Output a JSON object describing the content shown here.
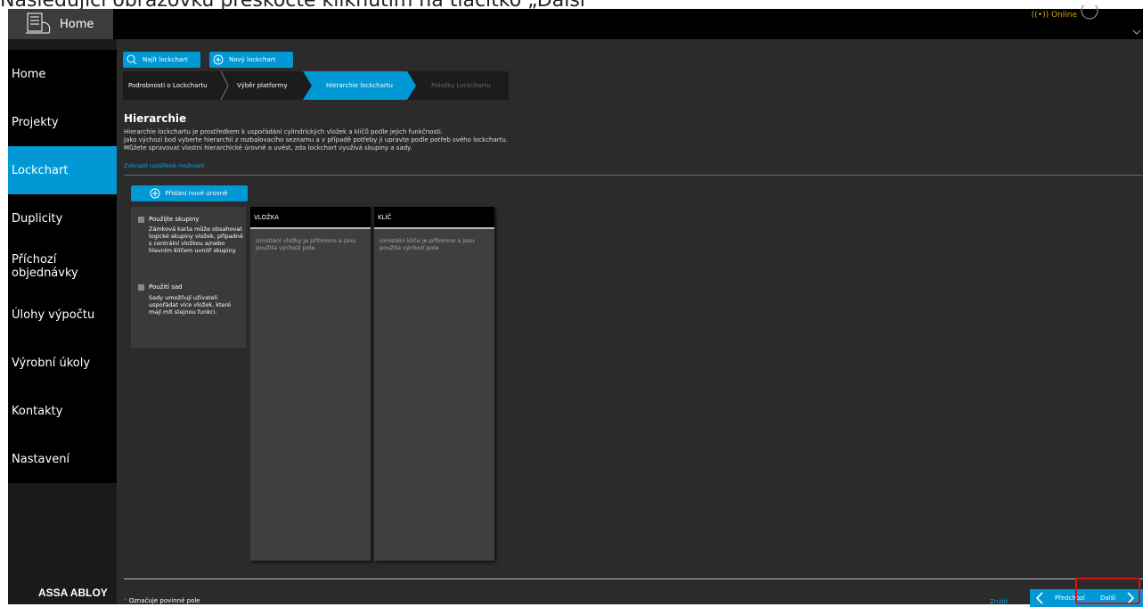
{
  "caption": "Následující obrazovku přeskočte kliknutím na tlačítko „Další“",
  "topbar": {
    "home_label": "Home",
    "status": "((•)) Online"
  },
  "sidebar": {
    "items": [
      {
        "label": "Home"
      },
      {
        "label": "Projekty"
      },
      {
        "label": "Lockchart"
      },
      {
        "label": "Duplicity"
      },
      {
        "label": "Příchozí objednávky"
      },
      {
        "label": "Úlohy výpočtu"
      },
      {
        "label": "Výrobní úkoly"
      },
      {
        "label": "Kontakty"
      },
      {
        "label": "Nastavení"
      }
    ],
    "active_index": 2,
    "brand": "ASSA ABLOY"
  },
  "toolbar": {
    "find_label": "Najít lockchart",
    "new_label": "Nový lockchart"
  },
  "steps": [
    {
      "label": "Podrobnosti o Lockchartu",
      "state": "done"
    },
    {
      "label": "Výběr platformy",
      "state": "done"
    },
    {
      "label": "Hierarchie lockchartu",
      "state": "active"
    },
    {
      "label": "Položky Lockchartu",
      "state": "pending"
    }
  ],
  "hierarchy": {
    "title": "Hierarchie",
    "desc1": "Hierarchie lockchartu je prostředkem k uspořádání cylindrických vložek a klíčů podle jejich funkčnosti.",
    "desc2": "Jako výchozí bod vyberte hierarchii z rozbalovacího seznamu a v případě potřeby ji upravte podle potřeb svého lockchartu.",
    "desc3": "Můžete spravovat vlastní hierarchické úrovně a uvést, zda lockchart využívá skupiny a sady.",
    "advanced_link": "Zobrazit rozšířené možnosti",
    "add_level_label": "Přidání nové úrovně"
  },
  "options": {
    "groups_label": "Použijte skupiny",
    "groups_desc": "Zámková karta může obsahovat logické skupiny vložek, případně s centrální vložkou a/nebo hlavním klíčem uvnitř skupiny.",
    "sets_label": "Použití sad",
    "sets_desc": "Sady umožňují uživateli uspořádat více vložek, které mají mít stejnou funkci."
  },
  "columns": [
    {
      "title": "VLOŽKA",
      "body": "Umístění vložky je přítomno a jsou použita výchozí pole"
    },
    {
      "title": "KLÍČ",
      "body": "Umístění klíče je přítomno a jsou použita výchozí pole"
    }
  ],
  "footer": {
    "required_star": "*",
    "required_note": "Označuje povinné pole",
    "cancel_label": "Zrušit",
    "prev_label": "Předchozí",
    "next_label": "Další"
  },
  "colors": {
    "accent": "#0099d6",
    "highlight": "#e01010",
    "online": "#e0a000"
  }
}
